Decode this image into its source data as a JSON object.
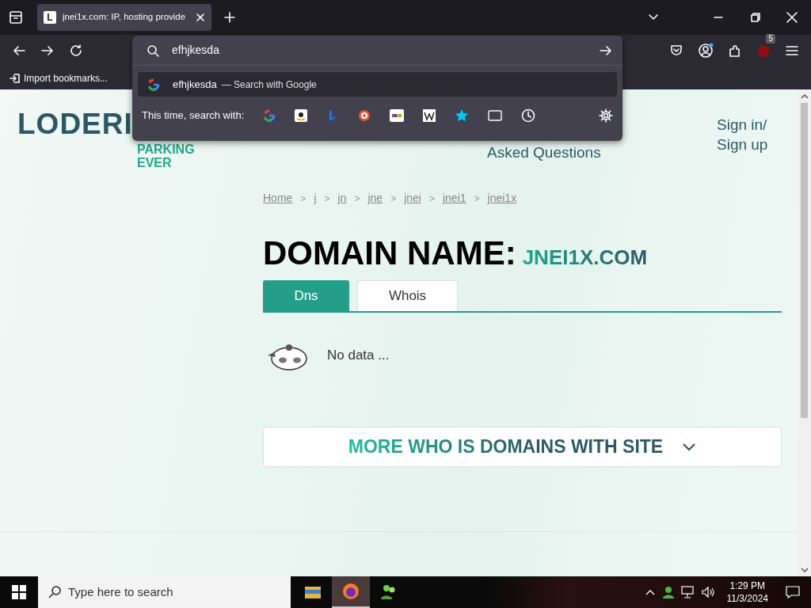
{
  "browser": {
    "tab": {
      "favicon": "L",
      "title": "jnei1x.com: IP, hosting provide"
    },
    "bookmarks": [
      {
        "label": "Import bookmarks..."
      }
    ],
    "address_bar": {
      "value": "efhjkesda"
    },
    "suggestion": {
      "query": "efhjkesda",
      "action": "— Search with Google",
      "selected": true
    },
    "search_with_label": "This time, search with:",
    "extension_badge": "5"
  },
  "page": {
    "logo": "LODERI",
    "tagline": [
      "PARKING",
      "EVER"
    ],
    "nav": [
      "Asked Questions"
    ],
    "sign": [
      "Sign in/",
      "Sign up"
    ],
    "breadcrumbs": [
      {
        "label": "Home"
      },
      {
        "separator": ">",
        "label": "j"
      },
      {
        "separator": ">",
        "label": "jn"
      },
      {
        "separator": ">",
        "label": "jne"
      },
      {
        "separator": ">",
        "label": "jnei"
      },
      {
        "separator": ">",
        "label": "jnei1"
      },
      {
        "separator": ">",
        "label": "jnei1x"
      }
    ],
    "heading": "DOMAIN NAME:",
    "domain": "JNEI1X.COM",
    "tabs": [
      {
        "label": "Dns",
        "selected": true
      },
      {
        "label": "Whois",
        "selected": false
      }
    ],
    "empty_text": "No data ...",
    "more_button": "MORE WHO IS DOMAINS WITH SITE"
  },
  "taskbar": {
    "search_placeholder": "Type here to search",
    "time": "1:29 PM",
    "date": "11/3/2024"
  }
}
